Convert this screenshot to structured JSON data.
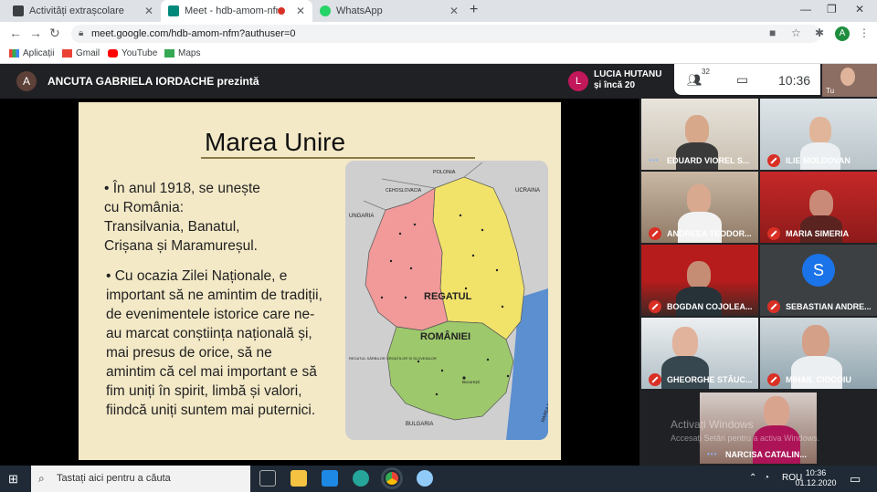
{
  "browser": {
    "tabs": [
      {
        "title": "Activități extrașcolare",
        "color": "#3c4043"
      },
      {
        "title": "Meet - hdb-amom-nfm",
        "color": "#00897b"
      },
      {
        "title": "WhatsApp",
        "color": "#25d366"
      }
    ],
    "url": "meet.google.com/hdb-amom-nfm?authuser=0",
    "profile_initial": "A",
    "bookmarks": [
      "Aplicații",
      "Gmail",
      "YouTube",
      "Maps"
    ]
  },
  "meet": {
    "presenter_initial": "A",
    "presenter_text": "ANCUTA GABRIELA IORDACHE prezintă",
    "pinned_initial": "L",
    "pinned_name": "LUCIA HUTANU",
    "pinned_others": "și încă 20",
    "participant_count": "32",
    "time": "10:36",
    "self_label": "Tu",
    "participants": [
      {
        "name": "EDUARD VIOREL S...",
        "muted": false
      },
      {
        "name": "ILIE MOLDOVAN",
        "muted": true
      },
      {
        "name": "ANDREEA TEODOR...",
        "muted": true
      },
      {
        "name": "MARIA SIMERIA",
        "muted": true
      },
      {
        "name": "BOGDAN COJOLEA...",
        "muted": true
      },
      {
        "name": "SEBASTIAN ANDRE...",
        "muted": true,
        "initial": "S"
      },
      {
        "name": "GHEORGHE STĂUC...",
        "muted": true
      },
      {
        "name": "MIHAIL CIOCOIU",
        "muted": true
      },
      {
        "name": "NARCISA CATALIN...",
        "muted": false
      }
    ],
    "watermark_title": "Activați Windows",
    "watermark_sub": "Accesați Setări pentru a activa Windows."
  },
  "slide": {
    "title": "Marea Unire",
    "bullet1": "• În anul 1918, se unește\n   cu România:\n   Transilvania, Banatul,\n   Crișana și Maramureșul.",
    "bullet2": "• Cu ocazia Zilei Naționale, e\nimportant să ne amintim de tradiții,\nde evenimentele istorice care ne-\nau marcat conștiința națională și,\nmai presus de orice, să ne\namintim că cel mai important e să\nfim uniți în spirit, limbă și valori,\nfiindcă uniți suntem mai puternici.",
    "map_labels": {
      "polonia": "POLONIA",
      "cehoslovacia": "CEHOSLOVACIA",
      "ucraina": "UCRAINA",
      "ungaria": "UNGARIA",
      "regatul": "REGATUL",
      "romaniei": "ROMÂNIEI",
      "serbia": "REGATUL SÂRBILOR CROAȚILOR ȘI SLOVENILOR",
      "bulgaria": "BULGARIA",
      "marea_neagra": "MAREA NEAGRĂ",
      "bucuresti": "București"
    }
  },
  "taskbar": {
    "search_placeholder": "Tastați aici pentru a căuta",
    "language": "ROU",
    "time": "10:36",
    "date": "01.12.2020"
  }
}
